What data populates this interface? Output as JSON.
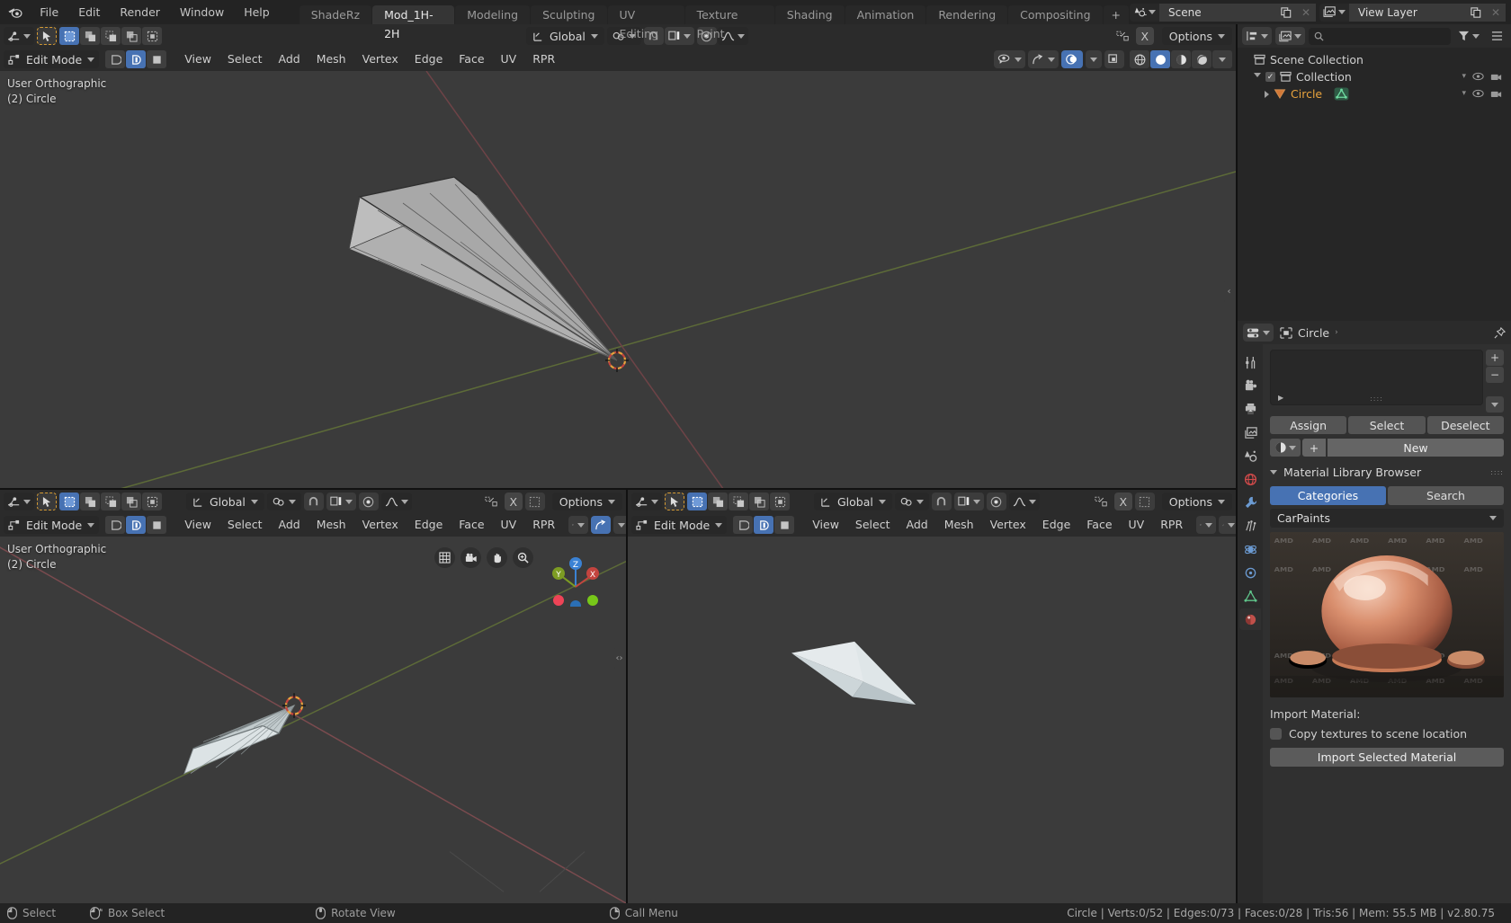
{
  "topbar": {
    "logo_icon": "blender-logo-icon",
    "menus": [
      "File",
      "Edit",
      "Render",
      "Window",
      "Help"
    ],
    "workspace_tabs": [
      {
        "label": "ShadeRz",
        "active": false
      },
      {
        "label": "Mod_1H-2H",
        "active": true
      },
      {
        "label": "Modeling",
        "active": false
      },
      {
        "label": "Sculpting",
        "active": false
      },
      {
        "label": "UV Editing",
        "active": false
      },
      {
        "label": "Texture Paint",
        "active": false
      },
      {
        "label": "Shading",
        "active": false
      },
      {
        "label": "Animation",
        "active": false
      },
      {
        "label": "Rendering",
        "active": false
      },
      {
        "label": "Compositing",
        "active": false
      }
    ],
    "add_workspace_label": "+",
    "scene_name": "Scene",
    "view_layer_name": "View Layer",
    "scene_icon": "scene-icon",
    "viewlayer_icon": "view-layer-icon",
    "copy_icon": "duplicate-icon",
    "close_icon": "close-x-icon"
  },
  "viewport_main": {
    "tool_icon": "editor-type-icon",
    "cursor_tool_icon": "tweak-cursor-icon",
    "select_modes": [
      "select-new",
      "select-extend",
      "select-subtract",
      "select-invert",
      "select-intersect"
    ],
    "transform_orientation": "Global",
    "orientation_icon": "orientation-icon",
    "pivot_icon": "pivot-point-icon",
    "snap_icon": "snap-magnet-icon",
    "snap_target_icon": "snap-target-icon",
    "proportional_icon": "proportional-edit-icon",
    "falloff_icon": "falloff-curve-icon",
    "options_label": "Options",
    "mirror_x_label": "X",
    "mirror_icon": "mirror-icon",
    "mode": "Edit Mode",
    "mode_icon": "edit-mode-icon",
    "mesh_select_modes": [
      "vertex-select-icon",
      "edge-select-icon",
      "face-select-icon"
    ],
    "mesh_select_active_index": 1,
    "menus": [
      "View",
      "Select",
      "Add",
      "Mesh",
      "Vertex",
      "Edge",
      "Face",
      "UV",
      "RPR"
    ],
    "visibility_icon": "visibility-selectability-icon",
    "gizmo_icon": "gizmo-icon",
    "overlays_icon": "overlays-icon",
    "xray_icon": "xray-toggle-icon",
    "shading_modes": [
      "wireframe-shading-icon",
      "solid-shading-icon",
      "material-preview-icon",
      "rendered-shading-icon"
    ],
    "overlay_text_line1": "User Orthographic",
    "overlay_text_line2": "(2) Circle"
  },
  "viewport_bottom_left": {
    "transform_orientation": "Global",
    "options_label": "Options",
    "mode": "Edit Mode",
    "menus": [
      "View",
      "Select",
      "Add",
      "Mesh",
      "Vertex",
      "Edge",
      "Face",
      "UV",
      "RPR"
    ],
    "overlay_text_line1": "User Orthographic",
    "overlay_text_line2": "(2) Circle",
    "mirror_x_label": "X",
    "nav_icons": [
      "grid-toggle-icon",
      "camera-view-icon",
      "pan-view-icon",
      "zoom-view-icon"
    ],
    "gizmo_axes": [
      {
        "label": "Z",
        "color": "#3b82d4"
      },
      {
        "label": "Y",
        "color": "#7d9c23"
      },
      {
        "label": "X",
        "color": "#c3443f"
      }
    ]
  },
  "viewport_bottom_right": {
    "transform_orientation": "Global",
    "options_label": "Options",
    "mode": "Edit Mode",
    "menus": [
      "View",
      "Select",
      "Add",
      "Mesh",
      "Vertex",
      "Edge",
      "Face",
      "UV",
      "RPR"
    ],
    "mirror_x_label": "X"
  },
  "outliner": {
    "display_mode_icon": "outliner-display-mode-icon",
    "filter_icon": "filter-icon",
    "search_icon": "search-icon",
    "search_placeholder": "",
    "filter_funnel_icon": "funnel-icon",
    "rows": [
      {
        "label": "Scene Collection",
        "icon": "collection-icon",
        "indent": 0,
        "has_tri": false,
        "has_checkbox": false,
        "color": "normal"
      },
      {
        "label": "Collection",
        "icon": "collection-icon",
        "indent": 1,
        "has_tri": true,
        "tri_open": true,
        "has_checkbox": true,
        "color": "normal"
      },
      {
        "label": "Circle",
        "icon": "mesh-object-icon",
        "indent": 2,
        "has_tri": true,
        "tri_open": false,
        "has_checkbox": false,
        "color": "orange",
        "data_icon": "mesh-data-icon"
      }
    ]
  },
  "properties": {
    "editor_icon": "properties-editor-icon",
    "breadcrumb_icon": "object-icon",
    "breadcrumb_label": "Circle",
    "pin_icon": "pin-icon",
    "tabs": [
      {
        "name": "tool-tab",
        "icon": "tool-icon",
        "active": false
      },
      {
        "name": "render-tab",
        "icon": "render-icon",
        "active": false
      },
      {
        "name": "output-tab",
        "icon": "printer-icon",
        "active": false
      },
      {
        "name": "view-layer-tab",
        "icon": "images-icon",
        "active": false
      },
      {
        "name": "scene-tab",
        "icon": "scene-cone-icon",
        "active": false
      },
      {
        "name": "world-tab",
        "icon": "world-icon",
        "active": false
      },
      {
        "name": "modifier-tab",
        "icon": "wrench-icon",
        "active": false
      },
      {
        "name": "particles-tab",
        "icon": "particles-icon",
        "active": false
      },
      {
        "name": "physics-tab",
        "icon": "physics-icon",
        "active": false
      },
      {
        "name": "constraints-tab",
        "icon": "constraints-icon",
        "active": false
      },
      {
        "name": "data-tab",
        "icon": "mesh-data-green-icon",
        "active": false
      },
      {
        "name": "material-tab",
        "icon": "material-sphere-icon",
        "active": true
      }
    ],
    "slot_add_icon": "+",
    "slot_remove_icon": "−",
    "slot_menu_icon": "chevron-down-icon",
    "slot_expand_icon": "expand-triangle-icon",
    "slot_grip_icon": "grip-dots-icon",
    "assign_label": "Assign",
    "select_label": "Select",
    "deselect_label": "Deselect",
    "material_browse_icon": "material-sphere-icon",
    "new_plus_label": "+",
    "new_label": "New",
    "library": {
      "panel_title": "Material Library Browser",
      "tabs": [
        {
          "label": "Categories",
          "active": true
        },
        {
          "label": "Search",
          "active": false
        }
      ],
      "category_value": "CarPaints",
      "preview_alt": "copper car paint material sphere preview with AMD watermark tiles",
      "preview_watermark": "AMD",
      "import_title": "Import Material:",
      "copy_textures_label": "Copy textures to scene location",
      "copy_textures_checked": false,
      "import_button_label": "Import Selected Material"
    }
  },
  "status_bar": {
    "hints": [
      {
        "icon": "mouse-left-icon",
        "label": "Select"
      },
      {
        "icon": "mouse-left-drag-icon",
        "label": "Box Select"
      },
      {
        "icon": "mouse-middle-icon",
        "label": "Rotate View"
      },
      {
        "icon": "mouse-right-icon",
        "label": "Call Menu"
      }
    ],
    "stats": "Circle | Verts:0/52 | Edges:0/73 | Faces:0/28 | Tris:56 | Mem: 55.5 MB | v2.80.75"
  },
  "colors": {
    "accent_blue": "#4772b3",
    "active_orange": "#e8a33d",
    "axis_x": "#b24a48",
    "axis_y": "#7d9c23",
    "viewport_bg": "#3b3b3b",
    "header_bg": "#2b2b2b",
    "panel_bg": "#303030"
  }
}
